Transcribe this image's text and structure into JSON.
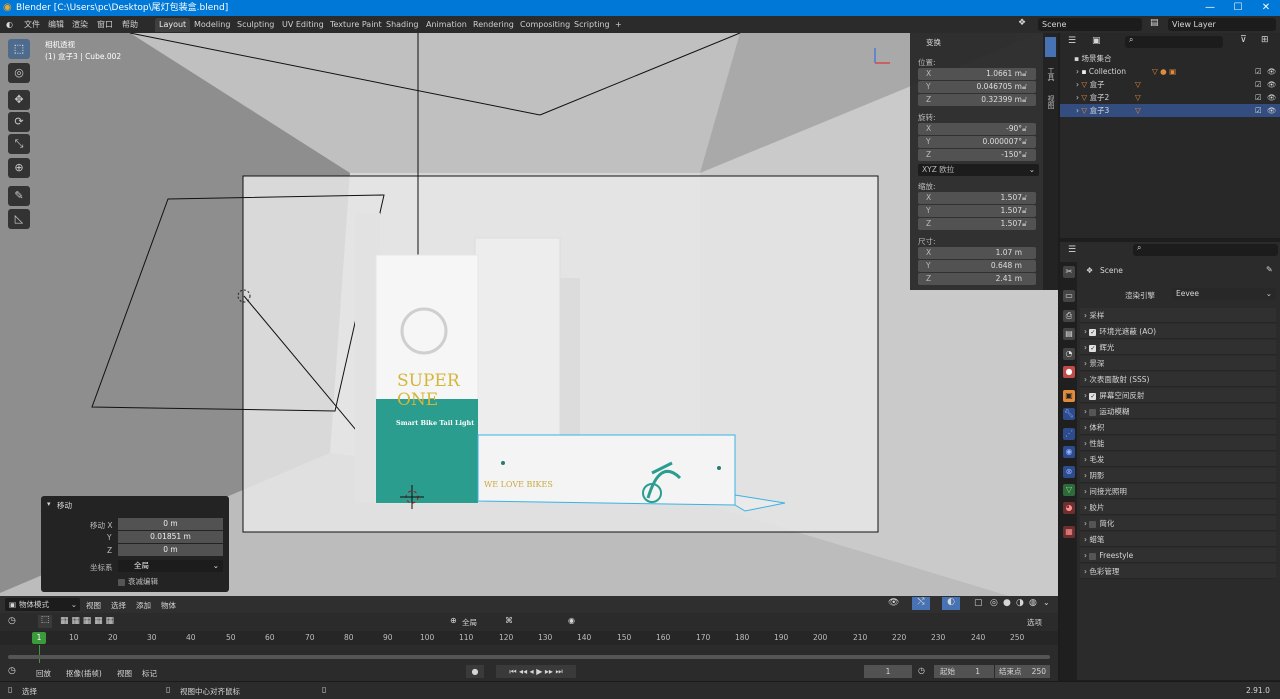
{
  "titlebar": {
    "title": "Blender [C:\\Users\\pc\\Desktop\\尾灯包装盒.blend]",
    "min": "—",
    "max": "☐",
    "close": "✕"
  },
  "menu": [
    "文件",
    "编辑",
    "渲染",
    "窗口",
    "帮助"
  ],
  "workspaces": [
    "Layout",
    "Modeling",
    "Sculpting",
    "UV Editing",
    "Texture Paint",
    "Shading",
    "Animation",
    "Rendering",
    "Compositing",
    "Scripting"
  ],
  "add_workspace": "+",
  "scene_name": "Scene",
  "view_layer": "View Layer",
  "viewport": {
    "view_name": "相机透视",
    "object_info": "(1) 盒子3 | Cube.002",
    "box_text1": "SUPER",
    "box_text2": "ONE",
    "box_text3": "Smart Bike Tail Light",
    "box_text4": "WE LOVE BIKES"
  },
  "transform": {
    "header": "变换",
    "location_label": "位置:",
    "location": {
      "x": "1.0661 m",
      "y": "0.046705 m",
      "z": "0.32399 m"
    },
    "rotation_label": "旋转:",
    "rotation": {
      "x": "-90°",
      "y": "0.000007°",
      "z": "-150°"
    },
    "rotation_mode": "XYZ 欧拉",
    "scale_label": "缩放:",
    "scale": {
      "x": "1.507",
      "y": "1.507",
      "z": "1.507"
    },
    "dimensions_label": "尺寸:",
    "dimensions": {
      "x": "1.07 m",
      "y": "0.648 m",
      "z": "2.41 m"
    },
    "tab1": "工具",
    "tab2": "视图"
  },
  "outliner": {
    "root": "场景集合",
    "items": [
      "Collection",
      "盒子",
      "盒子2",
      "盒子3"
    ]
  },
  "properties": {
    "scene": "Scene",
    "engine_label": "渲染引擎",
    "engine": "Eevee",
    "sections": [
      {
        "label": "采样",
        "check": false
      },
      {
        "label": "环境光遮蔽 (AO)",
        "check": true
      },
      {
        "label": "辉光",
        "check": true
      },
      {
        "label": "景深",
        "check": false
      },
      {
        "label": "次表面散射 (SSS)",
        "check": false
      },
      {
        "label": "屏幕空间反射",
        "check": true
      },
      {
        "label": "运动模糊",
        "check": false
      },
      {
        "label": "体积",
        "check": false
      },
      {
        "label": "性能",
        "check": false
      },
      {
        "label": "毛发",
        "check": false
      },
      {
        "label": "阴影",
        "check": false
      },
      {
        "label": "间接光照明",
        "check": false
      },
      {
        "label": "胶片",
        "check": false
      },
      {
        "label": "简化",
        "check": false
      },
      {
        "label": "蜡笔",
        "check": false
      },
      {
        "label": "Freestyle",
        "check": false
      },
      {
        "label": "色彩管理",
        "check": false
      }
    ]
  },
  "move_panel": {
    "title": "移动",
    "x_label": "移动 X",
    "x": "0 m",
    "y_label": "Y",
    "y": "0.01851 m",
    "z_label": "Z",
    "z": "0 m",
    "orient_label": "坐标系",
    "orient": "全局",
    "falloff": "衰减编辑"
  },
  "viewport_header": {
    "mode": "物体模式",
    "menus": [
      "视图",
      "选择",
      "添加",
      "物体"
    ]
  },
  "timeline": {
    "header_center": "全局",
    "options": "选项",
    "ticks": [
      "10",
      "20",
      "30",
      "40",
      "50",
      "60",
      "70",
      "80",
      "90",
      "100",
      "110",
      "120",
      "130",
      "140",
      "150",
      "160",
      "170",
      "180",
      "190",
      "200",
      "210",
      "220",
      "230",
      "240",
      "250"
    ],
    "current_frame_marker": "1",
    "footer_menus": [
      "回放",
      "抠像(插帧)",
      "视图",
      "标记"
    ],
    "current_frame": "1",
    "start_label": "起始",
    "start": "1",
    "end_label": "结束点",
    "end": "250"
  },
  "status": {
    "left": "选择",
    "middle": "视图中心对齐鼠标",
    "version": "2.91.0"
  }
}
